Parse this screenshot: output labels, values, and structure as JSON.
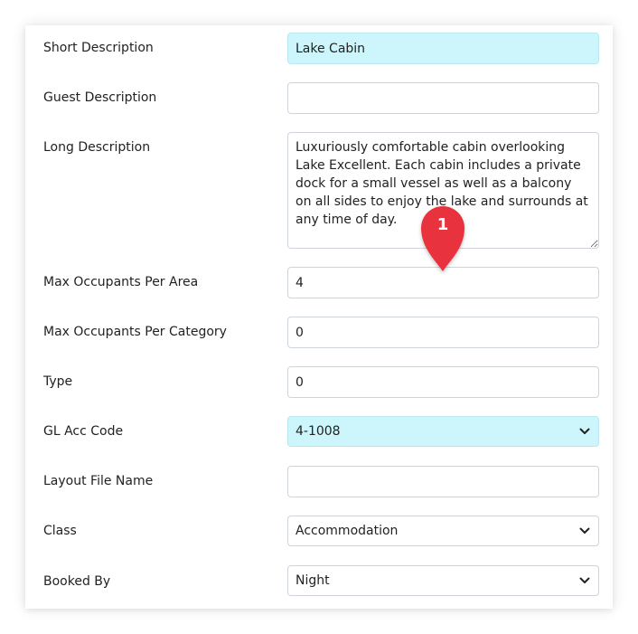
{
  "form": {
    "fields": [
      {
        "label": "Short Description",
        "value": "Lake Cabin"
      },
      {
        "label": "Guest Description",
        "value": ""
      },
      {
        "label": "Long Description",
        "value": "Luxuriously comfortable cabin overlooking Lake Excellent. Each cabin includes a private dock for a small vessel as well as a balcony on all sides to enjoy the lake and surrounds at any time of day."
      },
      {
        "label": "Max Occupants Per Area",
        "value": "4"
      },
      {
        "label": "Max Occupants Per Category",
        "value": "0"
      },
      {
        "label": "Type",
        "value": "0"
      },
      {
        "label": "GL Acc Code",
        "value": "4-1008"
      },
      {
        "label": "Layout File Name",
        "value": ""
      },
      {
        "label": "Class",
        "value": "Accommodation"
      },
      {
        "label": "Booked By",
        "value": "Night"
      }
    ]
  },
  "marker": {
    "number": "1",
    "color": "#e8303e",
    "icon": "map-pin-icon"
  },
  "colors": {
    "highlight": "#ccf6fb",
    "border": "#cfd4da"
  }
}
